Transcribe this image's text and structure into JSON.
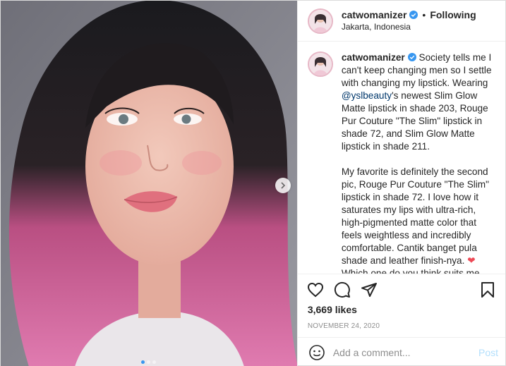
{
  "author": {
    "username": "catwomanizer",
    "follow_state": "Following",
    "location": "Jakarta, Indonesia",
    "separator": "•"
  },
  "caption": {
    "username": "catwomanizer",
    "part1": " Society tells me I can't keep changing men so I settle with changing my lipstick. Wearing ",
    "mention": "@yslbeauty",
    "part2": "'s newest Slim Glow Matte lipstick in shade 203, Rouge Pur Couture \"The Slim\" lipstick in shade 72, and Slim Glow Matte lipstick in shade 211.",
    "para2": "My favorite is definitely the second pic, Rouge Pur Couture \"The Slim\" lipstick in shade 72. I love how it saturates my lips with ultra-rich, high-pigmented matte color that feels weightless and incredibly comfortable. Cantik banget pula shade and leather finish-nya. ",
    "heart": "❤",
    "para2_end": " Which one do you think suits me better?"
  },
  "icons": {
    "like": "heart-icon",
    "comment": "comment-icon",
    "share": "share-icon",
    "save": "bookmark-icon",
    "emoji": "emoji-icon",
    "next": "chevron-right-icon",
    "verified": "verified-badge-icon"
  },
  "likes": "3,669 likes",
  "date": "November 24, 2020",
  "comment_box": {
    "placeholder": "Add a comment...",
    "post_label": "Post"
  },
  "carousel": {
    "slides": 3,
    "active_index": 0
  },
  "colors": {
    "accent": "#3897f0",
    "link": "#00376b",
    "post_disabled": "#b2dffc",
    "heart": "#ed4956"
  }
}
